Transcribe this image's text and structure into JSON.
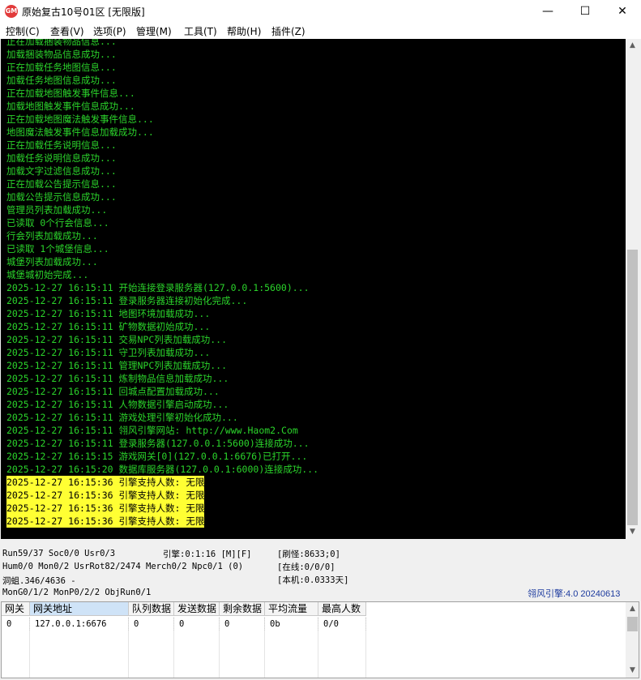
{
  "window": {
    "title": "原始复古10号01区 [无限版]",
    "icon_text": "GM",
    "minimize": "—",
    "maximize": "☐",
    "close": "✕"
  },
  "menu": [
    {
      "label": "控制(C)"
    },
    {
      "label": "查看(V)"
    },
    {
      "label": "选项(P)"
    },
    {
      "label": "管理(M)"
    },
    {
      "label": "工具(T)"
    },
    {
      "label": "帮助(H)"
    },
    {
      "label": "插件(Z)"
    }
  ],
  "log_lines": [
    {
      "text": "正在加载捆装物品信息...",
      "hl": false
    },
    {
      "text": "加载捆装物品信息成功...",
      "hl": false
    },
    {
      "text": "正在加载任务地图信息...",
      "hl": false
    },
    {
      "text": "加载任务地图信息成功...",
      "hl": false
    },
    {
      "text": "正在加载地图触发事件信息...",
      "hl": false
    },
    {
      "text": "加载地图触发事件信息成功...",
      "hl": false
    },
    {
      "text": "正在加载地图魔法触发事件信息...",
      "hl": false
    },
    {
      "text": "地图魔法触发事件信息加载成功...",
      "hl": false
    },
    {
      "text": "正在加载任务说明信息...",
      "hl": false
    },
    {
      "text": "加载任务说明信息成功...",
      "hl": false
    },
    {
      "text": "加载文字过滤信息成功...",
      "hl": false
    },
    {
      "text": "正在加载公告提示信息...",
      "hl": false
    },
    {
      "text": "加载公告提示信息成功...",
      "hl": false
    },
    {
      "text": "管理员列表加载成功...",
      "hl": false
    },
    {
      "text": "已读取 0个行会信息...",
      "hl": false
    },
    {
      "text": "行会列表加载成功...",
      "hl": false
    },
    {
      "text": "已读取 1个城堡信息...",
      "hl": false
    },
    {
      "text": "城堡列表加载成功...",
      "hl": false
    },
    {
      "text": "城堡城初始完成...",
      "hl": false
    },
    {
      "text": "2025-12-27 16:15:11 开始连接登录服务器(127.0.0.1:5600)...",
      "hl": false
    },
    {
      "text": "2025-12-27 16:15:11 登录服务器连接初始化完成...",
      "hl": false
    },
    {
      "text": "2025-12-27 16:15:11 地图环境加载成功...",
      "hl": false
    },
    {
      "text": "2025-12-27 16:15:11 矿物数据初始成功...",
      "hl": false
    },
    {
      "text": "2025-12-27 16:15:11 交易NPC列表加载成功...",
      "hl": false
    },
    {
      "text": "2025-12-27 16:15:11 守卫列表加载成功...",
      "hl": false
    },
    {
      "text": "2025-12-27 16:15:11 管理NPC列表加载成功...",
      "hl": false
    },
    {
      "text": "2025-12-27 16:15:11 炼制物品信息加载成功...",
      "hl": false
    },
    {
      "text": "2025-12-27 16:15:11 回城点配置加载成功...",
      "hl": false
    },
    {
      "text": "2025-12-27 16:15:11 人物数据引擎启动成功...",
      "hl": false
    },
    {
      "text": "2025-12-27 16:15:11 游戏处理引擎初始化成功...",
      "hl": false
    },
    {
      "text": "2025-12-27 16:15:11 翎风引擎网站: http://www.Haom2.Com",
      "hl": false
    },
    {
      "text": "2025-12-27 16:15:11 登录服务器(127.0.0.1:5600)连接成功...",
      "hl": false
    },
    {
      "text": "2025-12-27 16:15:15 游戏网关[0](127.0.0.1:6676)已打开...",
      "hl": false
    },
    {
      "text": "2025-12-27 16:15:20 数据库服务器(127.0.0.1:6000)连接成功...",
      "hl": false
    },
    {
      "text": "2025-12-27 16:15:36 引擎支持人数: 无限",
      "hl": true
    },
    {
      "text": "2025-12-27 16:15:36 引擎支持人数: 无限",
      "hl": true
    },
    {
      "text": "2025-12-27 16:15:36 引擎支持人数: 无限",
      "hl": true
    },
    {
      "text": "2025-12-27 16:15:36 引擎支持人数: 无限",
      "hl": true
    }
  ],
  "status": {
    "run": "Run59/37 Soc0/0 Usr0/3",
    "engine": "引擎:0:1:16 [M][F]",
    "refresh": "[刷怪:8633;0]",
    "hum": "Hum0/0 Mon0/2 UsrRot82/2474 Merch0/2 Npc0/1 (0)",
    "online": "[在线:0/0/0]",
    "cave": "洞蛆.346/4636 -",
    "local": "[本机:0.0333天]",
    "mong": "MonG0/1/2 MonP0/2/2 ObjRun0/1",
    "version": "翎风引擎:4.0 20240613"
  },
  "grid": {
    "columns": [
      "网关",
      "网关地址",
      "队列数据",
      "发送数据",
      "剩余数据",
      "平均流量",
      "最高人数"
    ],
    "rows": [
      [
        "0",
        "127.0.0.1:6676",
        "0",
        "0",
        "0",
        "0b",
        "0/0"
      ]
    ]
  },
  "colors": {
    "log_bg": "#000000",
    "log_text": "#2bd42b",
    "highlight_bg": "#ffff33",
    "version_text": "#1c3a9e"
  }
}
